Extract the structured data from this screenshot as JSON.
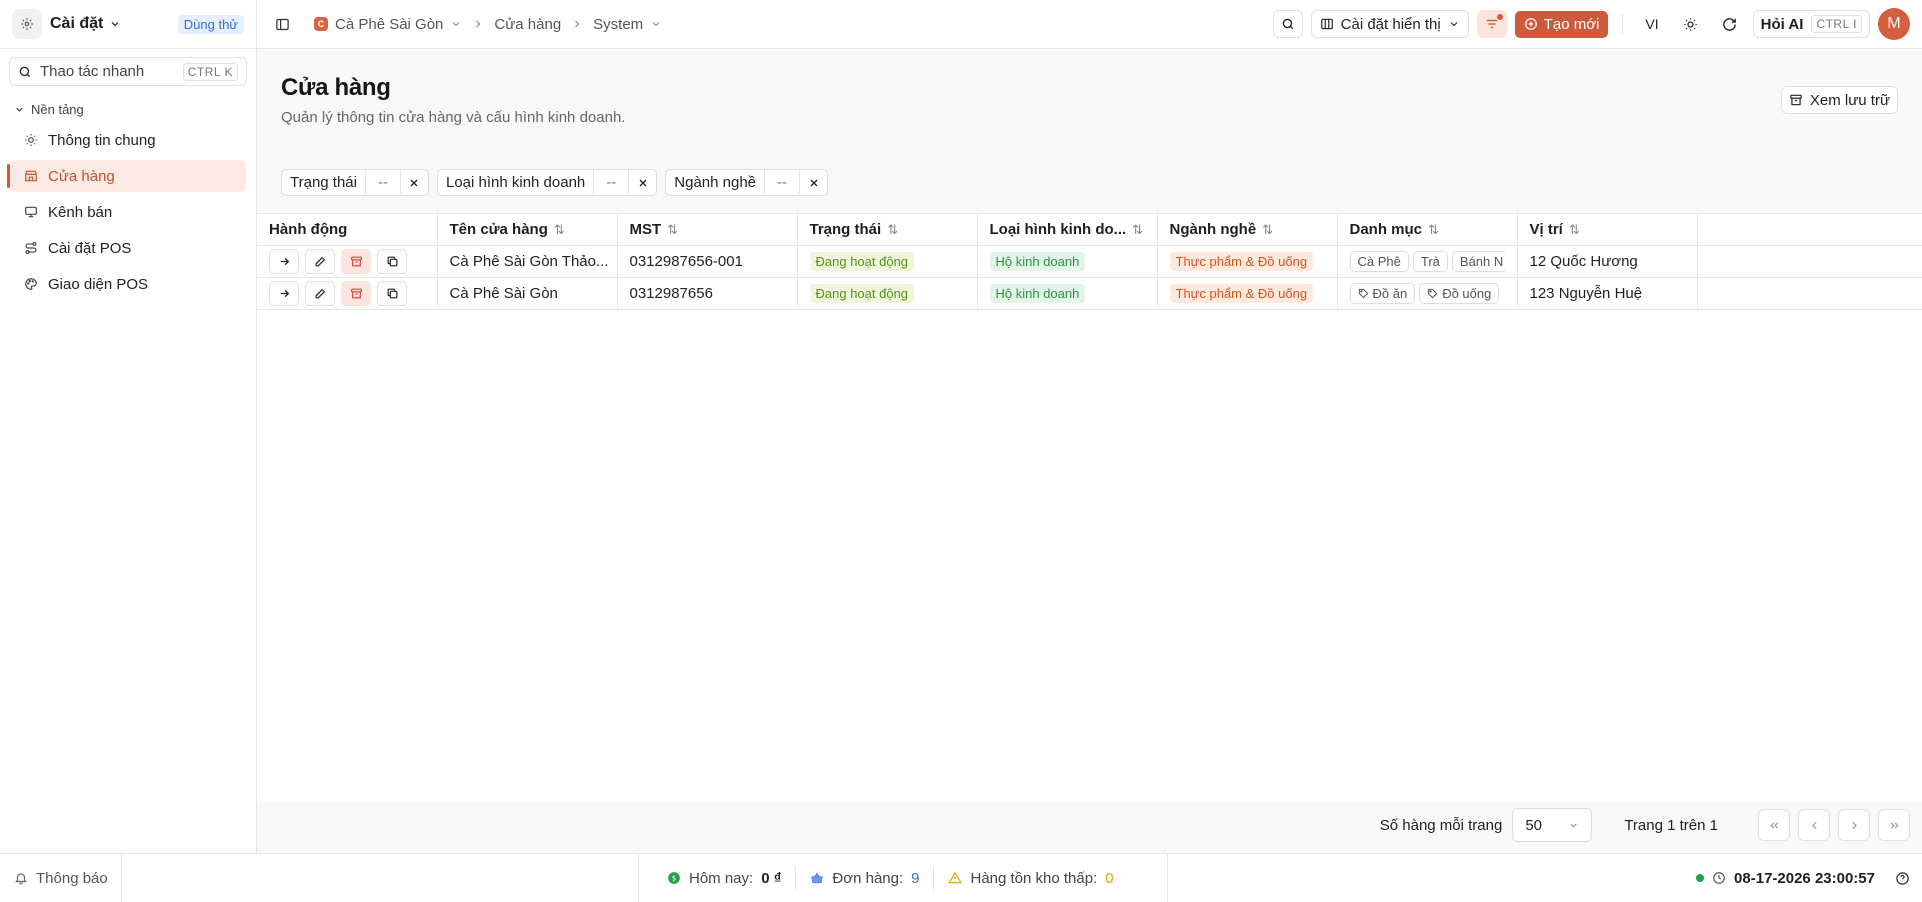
{
  "sidebar": {
    "title": "Cài đặt",
    "trial_badge": "Dùng thử",
    "search": {
      "placeholder": "Thao tác nhanh",
      "shortcut": "CTRL K"
    },
    "group_label": "Nền tảng",
    "items": [
      {
        "label": "Thông tin chung",
        "icon": "sun-icon"
      },
      {
        "label": "Cửa hàng",
        "icon": "store-icon",
        "active": true
      },
      {
        "label": "Kênh bán",
        "icon": "monitor-icon"
      },
      {
        "label": "Cài đặt POS",
        "icon": "route-icon"
      },
      {
        "label": "Giao diện POS",
        "icon": "palette-icon"
      }
    ]
  },
  "topbar": {
    "breadcrumbs": [
      {
        "label": "Cà Phê Sài Gòn",
        "store_initial": "C"
      },
      {
        "label": "Cửa hàng"
      },
      {
        "label": "System"
      }
    ],
    "display_settings": "Cài đặt hiển thị",
    "create_label": "Tạo mới",
    "language": "VI",
    "ai_label": "Hỏi AI",
    "ai_shortcut": "CTRL I",
    "avatar_initial": "M",
    "accent_color": "#cd5a3c"
  },
  "page": {
    "title": "Cửa hàng",
    "subtitle": "Quản lý thông tin cửa hàng và cấu hình kinh doanh.",
    "archive_label": "Xem lưu trữ"
  },
  "filters": [
    {
      "label": "Trạng thái",
      "value": "--"
    },
    {
      "label": "Loại hình kinh doanh",
      "value": "--"
    },
    {
      "label": "Ngành nghề",
      "value": "--"
    }
  ],
  "table": {
    "columns": [
      "Hành động",
      "Tên cửa hàng",
      "MST",
      "Trạng thái",
      "Loại hình kinh do...",
      "Ngành nghề",
      "Danh mục",
      "Vị trí"
    ],
    "rows": [
      {
        "name": "Cà Phê Sài Gòn Thảo...",
        "tax_id": "0312987656-001",
        "status": "Đang hoạt động",
        "business_type": "Hộ kinh doanh",
        "industry": "Thực phẩm & Đồ uống",
        "categories": [
          "Cà Phê",
          "Trà",
          "Bánh N"
        ],
        "location": "12 Quốc Hương"
      },
      {
        "name": "Cà Phê Sài Gòn",
        "tax_id": "0312987656",
        "status": "Đang hoạt động",
        "business_type": "Hộ kinh doanh",
        "industry": "Thực phẩm & Đồ uống",
        "categories": [
          "Đồ ăn",
          "Đồ uống"
        ],
        "location": "123 Nguyễn Huệ"
      }
    ]
  },
  "pagination": {
    "rows_per_page_label": "Số hàng mỗi trang",
    "rows_per_page": "50",
    "page_info": "Trang 1 trên 1"
  },
  "footer": {
    "notice_label": "Thông báo",
    "today_label": "Hôm nay:",
    "today_value": "0 ₫",
    "orders_label": "Đơn hàng:",
    "orders_value": "9",
    "low_stock_label": "Hàng tồn kho thấp:",
    "low_stock_value": "0",
    "datetime": "08-17-2026 23:00:57"
  }
}
